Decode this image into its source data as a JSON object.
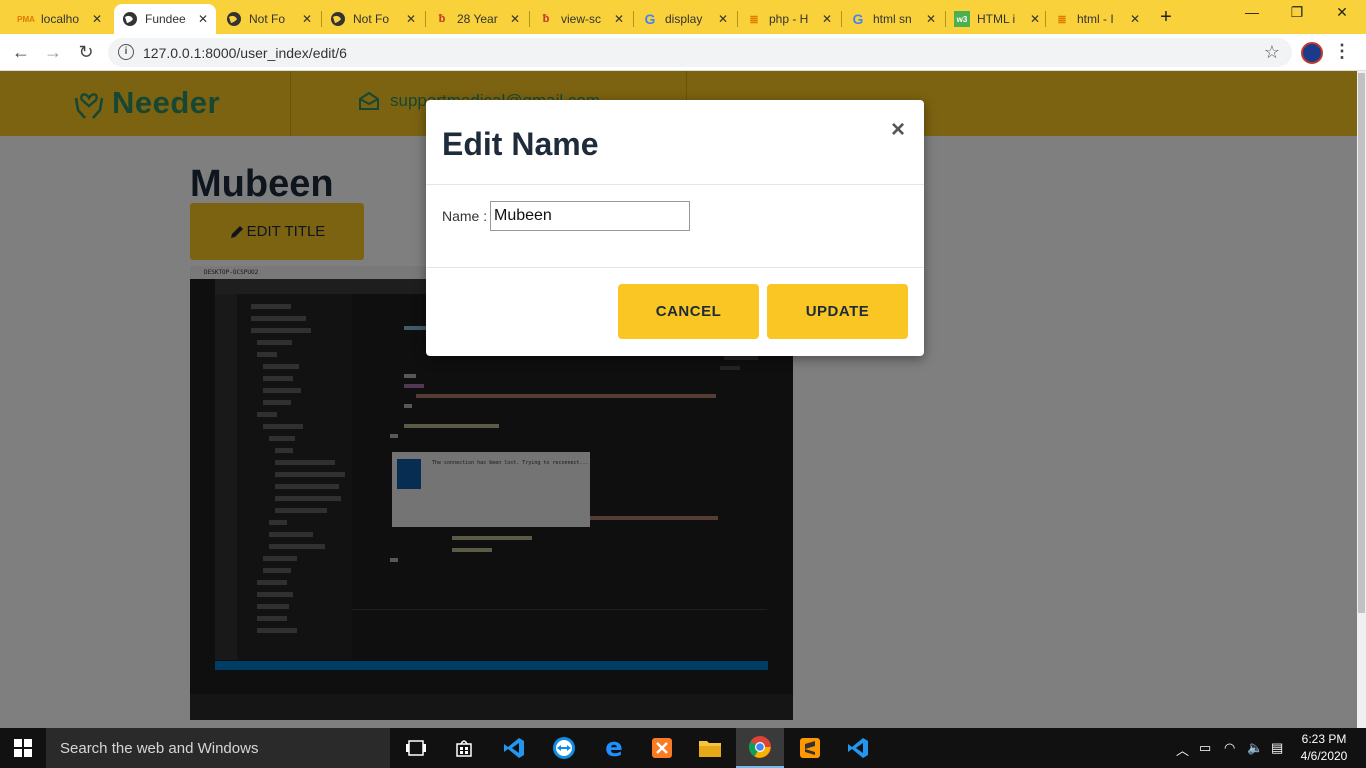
{
  "browser": {
    "tabs": [
      {
        "title": "localho",
        "favicon": "phpmyadmin-icon"
      },
      {
        "title": "Fundee",
        "favicon": "globe-icon",
        "active": true
      },
      {
        "title": "Not Fo",
        "favicon": "globe-icon"
      },
      {
        "title": "Not Fo",
        "favicon": "globe-icon"
      },
      {
        "title": "28 Year",
        "favicon": "laracasts-icon"
      },
      {
        "title": "view-sc",
        "favicon": "laracasts-icon"
      },
      {
        "title": "display",
        "favicon": "google-icon"
      },
      {
        "title": "php - H",
        "favicon": "stackoverflow-icon"
      },
      {
        "title": "html sn",
        "favicon": "google-icon"
      },
      {
        "title": "HTML i",
        "favicon": "w3schools-icon"
      },
      {
        "title": "html - I",
        "favicon": "stackoverflow-icon"
      }
    ],
    "new_tab_label": "+",
    "url": "127.0.0.1:8000/user_index/edit/6"
  },
  "site": {
    "logo_text": "Needer",
    "email": "supportmedical@gmail.com",
    "colors": {
      "header": "#f9c623",
      "logo": "#2f8f65",
      "heading": "#1d2b3a"
    }
  },
  "page": {
    "title": "Mubeen",
    "edit_title_label": "EDIT TITLE"
  },
  "screenshot": {
    "tab_title": "DESKTOP-OCSPUO2",
    "dialog_text": "The connection has been lost. Trying to reconnect..."
  },
  "modal": {
    "title": "Edit Name",
    "close_symbol": "×",
    "name_label": "Name :",
    "name_value": "Mubeen",
    "cancel_label": "CANCEL",
    "update_label": "UPDATE"
  },
  "taskbar": {
    "search_placeholder": "Search the web and Windows",
    "time": "6:23 PM",
    "date": "4/6/2020",
    "apps": [
      "task-view-icon",
      "store-icon",
      "vscode-icon",
      "teamviewer-icon",
      "edge-icon",
      "xampp-icon",
      "file-explorer-icon",
      "chrome-icon",
      "sublime-icon",
      "vscode-icon"
    ]
  }
}
